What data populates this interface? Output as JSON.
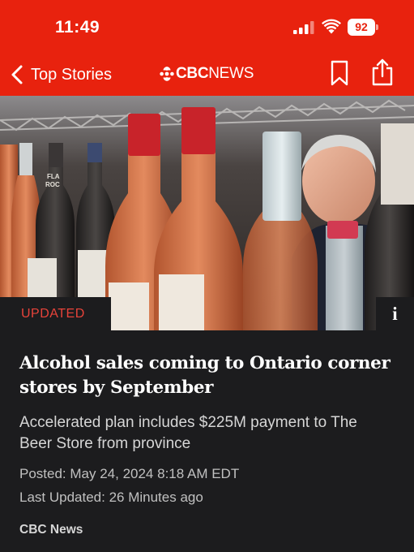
{
  "status_bar": {
    "time": "11:49",
    "battery": "92"
  },
  "nav": {
    "back_label": "Top Stories",
    "brand_cbc": "CBC",
    "brand_news": "NEWS"
  },
  "hero": {
    "badge": "UPDATED",
    "info_label": "i",
    "bottle_label": "FLA\nROC"
  },
  "article": {
    "headline": "Alcohol sales coming to Ontario corner stores by September",
    "subhead": "Accelerated plan includes $225M payment to The Beer Store from province",
    "posted": "Posted: May 24, 2024 8:18 AM EDT",
    "last_updated": "Last Updated: 26 Minutes ago",
    "source": "CBC News"
  },
  "colors": {
    "brand_red": "#e8220e",
    "background": "#1c1c1e",
    "badge_text": "#e8433a"
  }
}
